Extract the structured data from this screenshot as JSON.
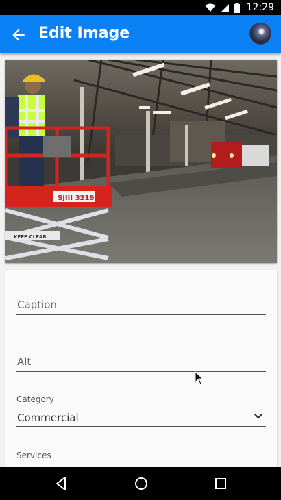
{
  "status_bar": {
    "time": "12:29",
    "icons": [
      "wifi-icon",
      "signal-icon",
      "battery-icon"
    ]
  },
  "app_bar": {
    "title": "Edit Image",
    "back_icon": "arrow-back-icon",
    "avatar": "user-avatar",
    "color": "#0a82f5"
  },
  "image": {
    "label_sticker": "SJIII 3219",
    "keep_clear": "KEEP CLEAR"
  },
  "form": {
    "caption": {
      "placeholder": "Caption",
      "value": ""
    },
    "alt": {
      "placeholder": "Alt",
      "value": ""
    },
    "category": {
      "label": "Category",
      "value": "Commercial"
    },
    "services": {
      "label": "Services"
    }
  },
  "nav_bar": {
    "icons": [
      "back-triangle-icon",
      "home-circle-icon",
      "recents-square-icon"
    ]
  }
}
